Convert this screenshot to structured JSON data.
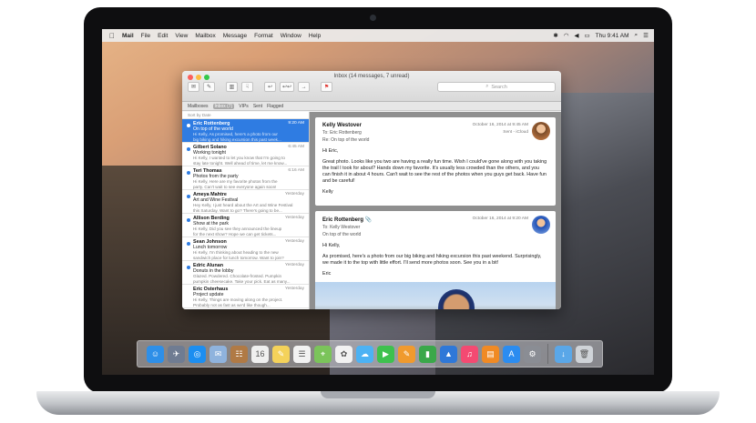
{
  "menubar": {
    "app": "Mail",
    "items": [
      "File",
      "Edit",
      "View",
      "Mailbox",
      "Message",
      "Format",
      "Window",
      "Help"
    ],
    "clock": "Thu 9:41 AM"
  },
  "window": {
    "title": "Inbox (14 messages, 7 unread)",
    "search_placeholder": "Search",
    "favorites": [
      "Mailboxes",
      "Inbox (7)",
      "VIPs",
      "Sent",
      "Flagged"
    ],
    "sort_label": "Sort by Date"
  },
  "messages": [
    {
      "sender": "Eric Rottenberg",
      "date": "9:20 AM",
      "subject": "On top of the world",
      "preview1": "Hi Kelly, As promised, here's a photo from our",
      "preview2": "big biking and hiking excursion this past week...",
      "unread": true,
      "selected": true
    },
    {
      "sender": "Gilbert Solano",
      "date": "6:45 AM",
      "subject": "Working tonight",
      "preview1": "Hi Kelly, I wanted to let you know that I'm going to",
      "preview2": "stay late tonight. Well ahead of time, let me know...",
      "unread": true,
      "selected": false
    },
    {
      "sender": "Teri Thomas",
      "date": "6:16 AM",
      "subject": "Photos from the party",
      "preview1": "Hi Kelly, Here are my favorite photos from the",
      "preview2": "party. Can't wait to see everyone again soon!",
      "unread": true,
      "selected": false
    },
    {
      "sender": "Ameya Mahtre",
      "date": "Yesterday",
      "subject": "Art and Wine Festival",
      "preview1": "Hey Kelly, I just heard about the Art and Wine Festival",
      "preview2": "this Saturday. Want to go? There's going to be...",
      "unread": true,
      "selected": false
    },
    {
      "sender": "Allison Berding",
      "date": "Yesterday",
      "subject": "Show at the park",
      "preview1": "Hi Kelly, Did you see they announced the lineup",
      "preview2": "for the next show? Hope we can get tickets...",
      "unread": true,
      "selected": false
    },
    {
      "sender": "Sean Johnson",
      "date": "Yesterday",
      "subject": "Lunch tomorrow",
      "preview1": "Hi Kelly, I'm thinking about heading to the new",
      "preview2": "sandwich place for lunch tomorrow. Want to join?",
      "unread": true,
      "selected": false
    },
    {
      "sender": "Edric Alunan",
      "date": "Yesterday",
      "subject": "Donuts in the lobby",
      "preview1": "Glazed. Powdered. Chocolate-frosted. Pumpkin",
      "preview2": "pumpkin cheesecake. Take your pick. Eat as many...",
      "unread": true,
      "selected": false
    },
    {
      "sender": "Eric Osterhaus",
      "date": "Yesterday",
      "subject": "Project update",
      "preview1": "Hi Kelly, Things are moving along on the project.",
      "preview2": "Probably not as fast as we'd like though...",
      "unread": false,
      "selected": false
    }
  ],
  "conversation": [
    {
      "from": "Kelly Westover",
      "date": "October 16, 2014 at 9:45 AM",
      "to_label": "To:",
      "to": "Eric Rottenberg",
      "sent": "Sent - iCloud",
      "subject": "Re: On top of the world",
      "greeting": "Hi Eric,",
      "body": "Great photo. Looks like you two are having a really fun time. Wish I could've gone along with you taking the trail I took for about? Hands down my favorite. It's usually less crowded than the others, and you can finish it in about 4 hours. Can't wait to see the rest of the photos when you guys get back. Have fun and be careful!",
      "signoff": "Kelly"
    },
    {
      "from": "Eric Rottenberg",
      "date": "October 16, 2014 at 9:20 AM",
      "to_label": "To:",
      "to": "Kelly Westover",
      "subject": "On top of the world",
      "greeting": "Hi Kelly,",
      "body": "As promised, here's a photo from our big biking and hiking excursion this past weekend. Surprisingly, we made it to the top with little effort. I'll send more photos soon. See you in a bit!",
      "signoff": "Eric"
    }
  ],
  "dock": {
    "icons": [
      {
        "name": "finder",
        "color": "#2e8fe8",
        "glyph": "☺"
      },
      {
        "name": "launchpad",
        "color": "#6f7c92",
        "glyph": "✈"
      },
      {
        "name": "safari",
        "color": "#1c8ef0",
        "glyph": "◎"
      },
      {
        "name": "mail",
        "color": "#8fb3dd",
        "glyph": "✉"
      },
      {
        "name": "contacts",
        "color": "#b07a45",
        "glyph": "☷"
      },
      {
        "name": "calendar",
        "color": "#f0f0f0",
        "glyph": "16"
      },
      {
        "name": "notes",
        "color": "#f4d25a",
        "glyph": "✎"
      },
      {
        "name": "reminders",
        "color": "#f2f2f2",
        "glyph": "☰"
      },
      {
        "name": "maps",
        "color": "#7bc45a",
        "glyph": "⌖"
      },
      {
        "name": "photos",
        "color": "#f2f2f2",
        "glyph": "✿"
      },
      {
        "name": "messages",
        "color": "#4cb2f4",
        "glyph": "☁"
      },
      {
        "name": "facetime",
        "color": "#3ec14e",
        "glyph": "▶"
      },
      {
        "name": "pages",
        "color": "#f09a2e",
        "glyph": "✎"
      },
      {
        "name": "numbers",
        "color": "#3aa84a",
        "glyph": "▮"
      },
      {
        "name": "keynote",
        "color": "#2f78d8",
        "glyph": "▲"
      },
      {
        "name": "itunes",
        "color": "#f44a72",
        "glyph": "♫"
      },
      {
        "name": "ibooks",
        "color": "#f08a24",
        "glyph": "▤"
      },
      {
        "name": "app-store",
        "color": "#2b8cf0",
        "glyph": "A"
      },
      {
        "name": "system-preferences",
        "color": "#8a8d94",
        "glyph": "⚙"
      },
      {
        "name": "downloads",
        "color": "#5aa7e8",
        "glyph": "↓"
      },
      {
        "name": "trash",
        "color": "#cfd3d8",
        "glyph": "🗑"
      }
    ]
  }
}
